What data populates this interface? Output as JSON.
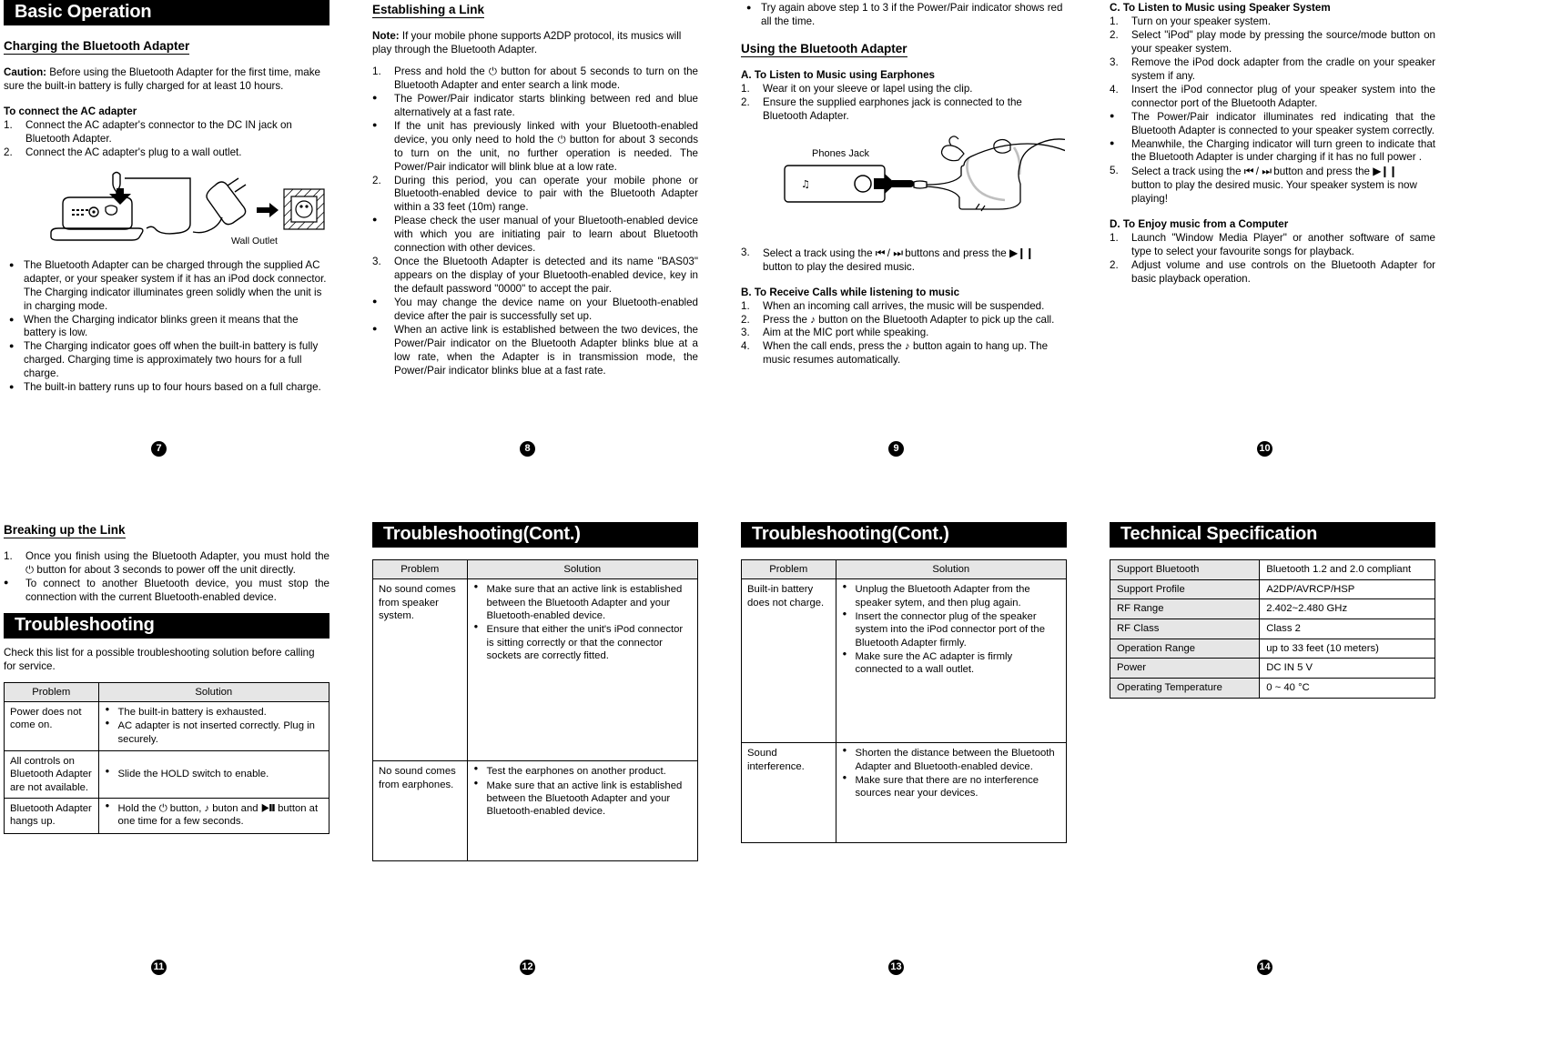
{
  "pages": {
    "p7": {
      "number": "7",
      "banner": "Basic Operation",
      "subhead": "Charging the Bluetooth Adapter",
      "caution_label": "Caution:",
      "caution_text": " Before using the Bluetooth Adapter for the first time, make sure the built-in battery is fully charged for at least 10 hours.",
      "connect_head": "To connect the AC adapter",
      "steps": [
        {
          "mark": "1.",
          "text": "Connect the AC adapter's connector to the DC IN jack on Bluetooth Adapter."
        },
        {
          "mark": "2.",
          "text": "Connect the AC adapter's plug to a wall outlet."
        }
      ],
      "figure_label": "Wall Outlet",
      "notes": [
        "The Bluetooth Adapter can be charged through the supplied AC adapter, or your speaker system if it has an iPod dock connector.",
        "When the Charging indicator blinks green it means that the battery is low.",
        "The Charging indicator goes off when the built-in battery is fully charged. Charging time is approximately two hours for a full charge.",
        "The built-in battery runs up to four hours based on a full charge."
      ],
      "note1_extra": "The Charging indicator illuminates green solidly when the unit is in charging mode."
    },
    "p8": {
      "number": "8",
      "subhead": "Establishing a Link",
      "note_label": "Note:",
      "note_text": " If your mobile phone supports A2DP protocol, its musics will play through the Bluetooth Adapter.",
      "items": [
        {
          "mark": "1.",
          "text": "Press and hold the ⏻ button for about 5 seconds to turn on the Bluetooth Adapter and enter search a link mode."
        },
        {
          "mark": "●",
          "text": "The Power/Pair indicator starts blinking between red and blue alternatively at a fast rate."
        },
        {
          "mark": "●",
          "text": "If the unit has previously linked with your Bluetooth-enabled device, you only need to hold the ⏻ button for about 3 seconds to turn on the unit, no further operation is needed. The Power/Pair indicator will blink blue at a low rate."
        },
        {
          "mark": "2.",
          "text": "During this period, you can operate your mobile phone or Bluetooth-enabled device to pair with the Bluetooth Adapter within a 33 feet (10m) range."
        },
        {
          "mark": "●",
          "text": "Please check the user manual of your Bluetooth-enabled device with which you are initiating pair to learn about Bluetooth connection with other devices."
        },
        {
          "mark": "3.",
          "text": "Once the Bluetooth Adapter is detected and its name \"BAS03\" appears on the display of your Bluetooth-enabled device, key in the default password \"0000\" to accept the pair."
        },
        {
          "mark": "●",
          "text": "You may change the device name on your Bluetooth-enabled device after the pair is successfully set up."
        },
        {
          "mark": "●",
          "text": "When an active link is established between the two devices, the Power/Pair indicator on the Bluetooth Adapter blinks blue at a low rate, when the Adapter is in transmission mode,  the Power/Pair indicator blinks blue at a fast rate."
        }
      ]
    },
    "p9": {
      "number": "9",
      "top_bullet": "Try again above step 1 to 3 if the Power/Pair indicator shows red all the time.",
      "subhead": "Using the Bluetooth Adapter",
      "sectionA_title": "A.  To Listen to Music using Earphones",
      "sectionA_items": [
        {
          "mark": "1.",
          "text": "Wear it on your sleeve or lapel using the clip."
        },
        {
          "mark": "2.",
          "text": "Ensure the supplied earphones jack is connected to the Bluetooth Adapter."
        }
      ],
      "figure_label": "Phones Jack",
      "step3": {
        "mark": "3.",
        "pre": "Select a track using the ",
        "mid": " buttons and press the ",
        "post": "button to play the desired music."
      },
      "sectionB_title": "B.  To Receive Calls while listening to music",
      "sectionB_items": [
        {
          "mark": "1.",
          "text": "When an incoming call arrives, the music will be suspended."
        },
        {
          "mark": "2.",
          "text": "Press the ♪ button on the Bluetooth Adapter to pick up the call."
        },
        {
          "mark": "3.",
          "text": "Aim at the MIC port while speaking."
        },
        {
          "mark": "4.",
          "text": "When the call ends, press the ♪ button again to hang up. The music resumes automatically."
        }
      ]
    },
    "p10": {
      "number": "10",
      "sectionC_title": "C.  To Listen to Music using Speaker System",
      "sectionC_items": [
        {
          "mark": "1.",
          "text": "Turn on your speaker system."
        },
        {
          "mark": "2.",
          "text": "Select \"iPod\" play mode by pressing the source/mode button on your speaker system."
        },
        {
          "mark": "3.",
          "text": "Remove the iPod dock adapter from the cradle on your speaker system if any."
        },
        {
          "mark": "4.",
          "text": "Insert the iPod connector plug of your speaker system into the connector port of the Bluetooth Adapter."
        },
        {
          "mark": "●",
          "text": "The Power/Pair indicator illuminates red indicating that the Bluetooth Adapter is connected to your speaker system correctly."
        },
        {
          "mark": "●",
          "text": "Meanwhile, the Charging indicator will turn green to indicate that the Bluetooth Adapter is under charging if it has no full power ."
        }
      ],
      "step5": {
        "mark": "5.",
        "pre": "Select a track using the ",
        "mid": "  button and press the ",
        "post": "button to play the desired music. Your speaker system is now playing!"
      },
      "sectionD_title": "D.  To Enjoy music from a Computer",
      "sectionD_items": [
        {
          "mark": "1.",
          "text": "Launch \"Window Media Player\" or another software of same type to select your favourite songs for playback."
        },
        {
          "mark": "2.",
          "text": "Adjust volume and use controls on the Bluetooth Adapter for basic playback operation."
        }
      ]
    },
    "p11": {
      "number": "11",
      "subhead": "Breaking up the Link",
      "items": [
        {
          "mark": "1.",
          "text": "Once you finish using the Bluetooth Adapter, you must hold the ⏻  button for about 3 seconds to power off the unit directly."
        },
        {
          "mark": "●",
          "text": "To connect to another Bluetooth device, you must stop the connection with the current Bluetooth-enabled device."
        }
      ],
      "banner": "Troubleshooting",
      "intro": "Check this list for a possible troubleshooting solution before calling for service.",
      "table": {
        "headers": [
          "Problem",
          "Solution"
        ],
        "rows": [
          {
            "problem": "Power does not come on.",
            "solutions": [
              "The built-in battery is exhausted.",
              "AC adapter is not inserted correctly. Plug in securely."
            ]
          },
          {
            "problem": "All controls on Bluetooth Adapter are not available.",
            "solutions": [
              "Slide the HOLD switch to enable."
            ]
          },
          {
            "problem": "Bluetooth Adapter hangs up.",
            "solutions": [
              "Hold the ⏻ button, ♪ buton and ▶❙❙ button at one time for a few seconds."
            ]
          }
        ]
      }
    },
    "p12": {
      "number": "12",
      "banner": "Troubleshooting(Cont.)",
      "table": {
        "headers": [
          "Problem",
          "Solution"
        ],
        "rows": [
          {
            "problem": "No sound comes from speaker system.",
            "solutions": [
              "Make sure that an active link is established between the Bluetooth Adapter and your Bluetooth-enabled device.",
              "Ensure that either the unit's iPod connector is sitting correctly or that the connector sockets are correctly fitted."
            ]
          },
          {
            "problem": "No sound comes from earphones.",
            "solutions": [
              "Test the earphones on another product.",
              "Make sure that an active link is established between the Bluetooth Adapter and your Bluetooth-enabled device."
            ]
          }
        ]
      }
    },
    "p13": {
      "number": "13",
      "banner": "Troubleshooting(Cont.)",
      "table": {
        "headers": [
          "Problem",
          "Solution"
        ],
        "rows": [
          {
            "problem": "Built-in battery does not charge.",
            "solutions": [
              "Unplug the Bluetooth Adapter from the speaker sytem, and then plug again.",
              "Insert the connector plug of the speaker system into the iPod connector port of the Bluetooth Adapter firmly.",
              "Make sure the AC adapter is firmly connected to a wall outlet."
            ]
          },
          {
            "problem": "Sound interference.",
            "solutions": [
              "Shorten the distance between the Bluetooth Adapter and Bluetooth-enabled device.",
              "Make sure that there are no interference sources near your devices."
            ]
          }
        ]
      }
    },
    "p14": {
      "number": "14",
      "banner": "Technical Specification",
      "spec": [
        {
          "key": "Support Bluetooth",
          "value": "Bluetooth 1.2 and 2.0 compliant"
        },
        {
          "key": "Support Profile",
          "value": "A2DP/AVRCP/HSP"
        },
        {
          "key": "RF Range",
          "value": "2.402~2.480 GHz"
        },
        {
          "key": "RF Class",
          "value": "Class 2"
        },
        {
          "key": "Operation Range",
          "value": "up to 33 feet (10 meters)"
        },
        {
          "key": "Power",
          "value": "DC IN 5 V"
        },
        {
          "key": "Operating Temperature",
          "value": "0 ~ 40 °C"
        }
      ]
    }
  },
  "symbols": {
    "power": "⏻",
    "prev": "⏮",
    "next": "⏭",
    "playpause": "▶❙❙",
    "call": "♪",
    "bullet": "●"
  }
}
